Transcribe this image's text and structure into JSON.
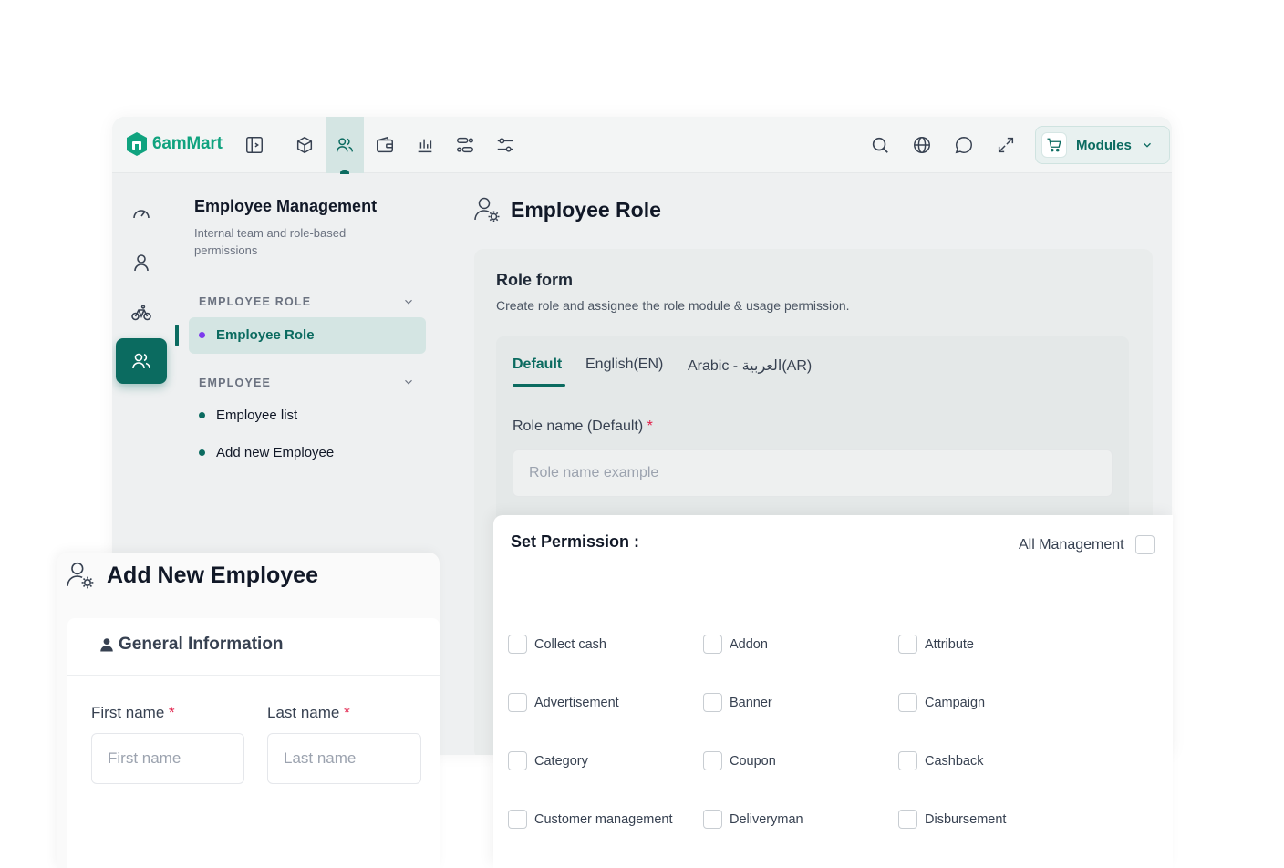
{
  "app": {
    "logo_text": "6amMart",
    "modules_label": "Modules"
  },
  "sidebar": {
    "title": "Employee Management",
    "subtitle": "Internal team and role-based permissions",
    "sections": [
      {
        "label": "EMPLOYEE ROLE",
        "items": [
          {
            "label": "Employee Role",
            "active": true
          }
        ]
      },
      {
        "label": "EMPLOYEE",
        "items": [
          {
            "label": "Employee list"
          },
          {
            "label": "Add new Employee"
          }
        ]
      }
    ]
  },
  "main": {
    "page_title": "Employee Role",
    "role_form": {
      "title": "Role form",
      "subtitle": "Create role and assignee the role module & usage permission.",
      "tabs": [
        "Default",
        "English(EN)",
        "Arabic - العربية(AR)"
      ],
      "role_name_label": "Role name (Default)",
      "required_mark": "*",
      "role_name_placeholder": "Role name example"
    }
  },
  "permissions": {
    "title": "Set Permission :",
    "all_management_label": "All Management",
    "items": [
      "Collect cash",
      "Addon",
      "Attribute",
      "Advertisement",
      "Banner",
      "Campaign",
      "Category",
      "Coupon",
      "Cashback",
      "Customer management",
      "Deliveryman",
      "Disbursement"
    ]
  },
  "add_employee": {
    "title": "Add New Employee",
    "section_title": "General Information",
    "first_name_label": "First name",
    "last_name_label": "Last name",
    "required_mark": "*",
    "first_name_placeholder": "First name",
    "last_name_placeholder": "Last name"
  },
  "colors": {
    "brand": "#0b6b60",
    "logo_green": "#10a37f",
    "required": "#e11d48"
  }
}
